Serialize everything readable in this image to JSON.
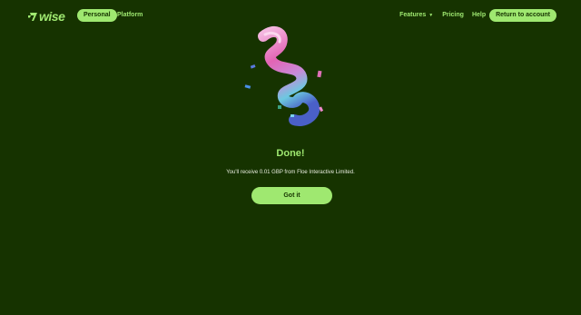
{
  "header": {
    "logo_text": "wise",
    "nav_personal": "Personal",
    "nav_platform": "Platform",
    "nav_features": "Features",
    "nav_pricing": "Pricing",
    "nav_help": "Help",
    "return_button": "Return to account"
  },
  "main": {
    "title": "Done!",
    "message": "You'll receive 0.01 GBP from Floe Interactive Limited.",
    "button": "Got it"
  },
  "colors": {
    "background": "#163300",
    "accent": "#9fe870"
  },
  "icons": {
    "logo": "wise-flag-icon",
    "features_dropdown": "chevron-down-icon",
    "illustration": "confetti-ribbon-illustration"
  }
}
